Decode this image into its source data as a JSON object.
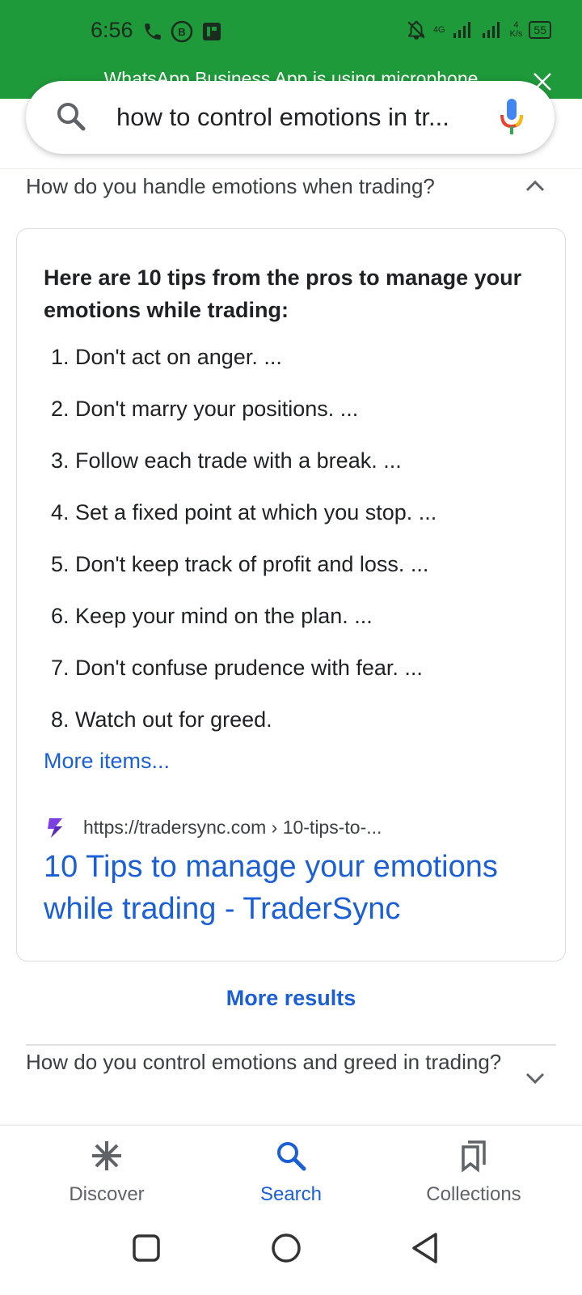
{
  "status_bar": {
    "time": "6:56",
    "network_label": "4G",
    "speed_value": "4",
    "speed_unit": "K/s",
    "battery": "55"
  },
  "notification": {
    "text": "WhatsApp Business App is using microphone"
  },
  "search": {
    "query": "how to control emotions in tr..."
  },
  "faq_open": {
    "question": "How do you handle emotions when trading?"
  },
  "answer": {
    "heading": "Here are 10 tips from the pros to manage your emotions while trading:",
    "items": [
      "1. Don't act on anger. ...",
      "2. Don't marry your positions. ...",
      "3. Follow each trade with a break. ...",
      "4. Set a fixed point at which you stop. ...",
      "5. Don't keep track of profit and loss. ...",
      "6. Keep your mind on the plan. ...",
      "7. Don't confuse prudence with fear. ...",
      "8. Watch out for greed."
    ],
    "more_items": "More items...",
    "source_url": "https://tradersync.com › 10-tips-to-...",
    "result_title": "10 Tips to manage your emotions while trading - TraderSync"
  },
  "more_results": "More results",
  "faq_next": {
    "question": "How do you control emotions and greed in trading?"
  },
  "bottom_nav": {
    "discover": "Discover",
    "search": "Search",
    "collections": "Collections"
  },
  "colors": {
    "status_green": "#1f9a3a",
    "link_blue": "#1a5fd6"
  }
}
